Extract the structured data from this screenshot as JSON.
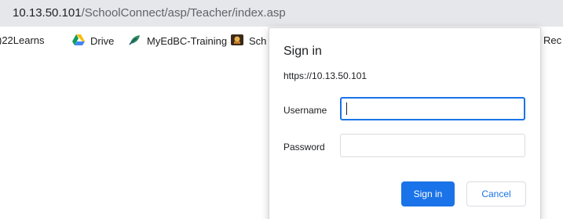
{
  "browser": {
    "url_host": "10.13.50.101",
    "url_path": "/SchoolConnect/asp/Teacher/index.asp"
  },
  "bookmarks": [
    {
      "label": ")22Learns",
      "icon": "none"
    },
    {
      "label": "Drive",
      "icon": "google-drive-icon"
    },
    {
      "label": "MyEdBC-Training",
      "icon": "leaf-icon"
    },
    {
      "label": "Sch",
      "icon": "school-icon"
    },
    {
      "label": "Rec",
      "icon": "none"
    }
  ],
  "dialog": {
    "title": "Sign in",
    "origin": "https://10.13.50.101",
    "username_label": "Username",
    "username_value": "",
    "password_label": "Password",
    "password_value": "",
    "signin_label": "Sign in",
    "cancel_label": "Cancel"
  },
  "colors": {
    "accent": "#1a73e8",
    "address_bar_bg": "#e6e7ea"
  }
}
